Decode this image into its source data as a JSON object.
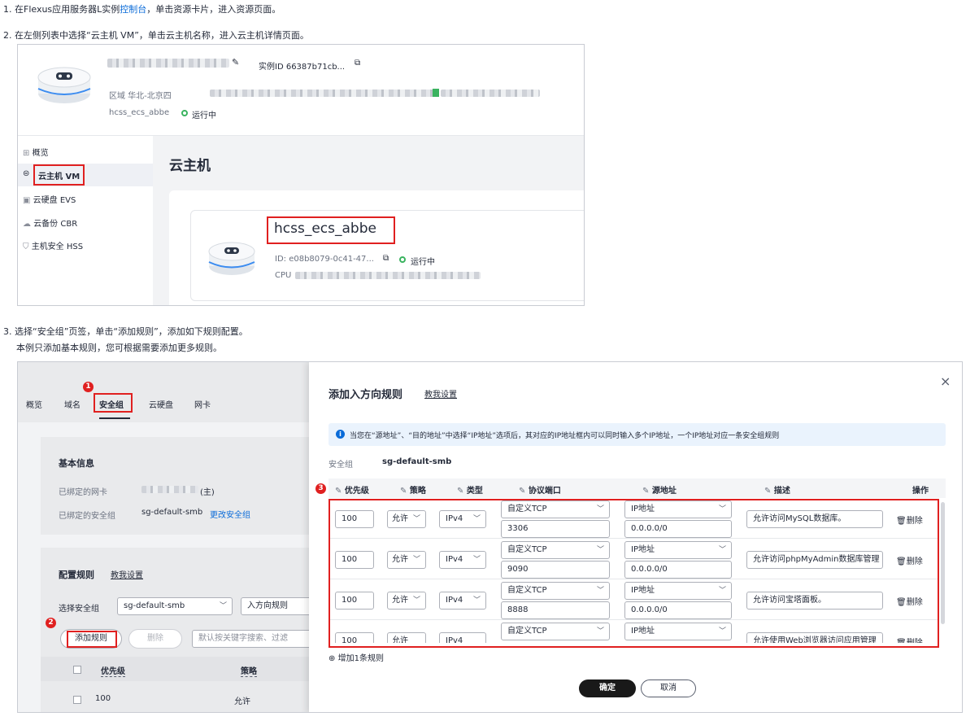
{
  "steps": {
    "s1_a": "1. 在Flexus应用服务器L实例",
    "s1_link": "控制台",
    "s1_b": "，单击资源卡片，进入资源页面。",
    "s2": "2. 在左侧列表中选择“云主机 VM”，单击云主机名称，进入云主机详情页面。",
    "s3": "3. 选择“安全组”页签，单击“添加规则”，添加如下规则配置。",
    "s3_sub": "本例只添加基本规则，您可根据需要添加更多规则。"
  },
  "shot1": {
    "instance_label": "实例ID 66387b71cb...",
    "region": "区域 华北-北京四",
    "host_name_small": "hcss_ecs_abbe",
    "status": "运行中",
    "nav": [
      "概览",
      "云主机 VM",
      "云硬盘 EVS",
      "云备份 CBR",
      "主机安全 HSS"
    ],
    "page_title": "云主机",
    "card_name": "hcss_ecs_abbe",
    "card_id": "ID: e08b8079-0c41-47...",
    "card_status": "运行中",
    "card_cpu": "CPU"
  },
  "shot2": {
    "tabs": [
      "概览",
      "域名",
      "安全组",
      "云硬盘",
      "网卡"
    ],
    "basic_title": "基本信息",
    "bound_nic": "已绑定的网卡",
    "nic_suffix": "(主)",
    "bound_sg": "已绑定的安全组",
    "sg_value": "sg-default-smb",
    "change_sg": "更改安全组",
    "config_title": "配置规则",
    "teach": "教我设置",
    "select_sg": "选择安全组",
    "sg_select_value": "sg-default-smb",
    "direction": "入方向规则",
    "add_rule": "添加规则",
    "delete": "删除",
    "search_placeholder": "默认按关键字搜索、过滤",
    "col_priority": "优先级",
    "col_policy": "策略",
    "row_priority": "100",
    "row_policy": "允许",
    "badges": [
      "1",
      "2",
      "3"
    ]
  },
  "dialog": {
    "title": "添加入方向规则",
    "teach": "教我设置",
    "close": "×",
    "info": "当您在“源地址”、“目的地址”中选择“IP地址”选项后，其对应的IP地址框内可以同时输入多个IP地址，一个IP地址对应一条安全组规则",
    "sg_label": "安全组",
    "sg_value": "sg-default-smb",
    "headers": [
      "优先级",
      "策略",
      "类型",
      "协议端口",
      "源地址",
      "描述",
      "操作"
    ],
    "rows": [
      {
        "priority": "100",
        "policy": "允许",
        "type": "IPv4",
        "protocol": "自定义TCP",
        "port": "3306",
        "src_type": "IP地址",
        "src": "0.0.0.0/0",
        "desc": "允许访问MySQL数据库。",
        "op": "删除"
      },
      {
        "priority": "100",
        "policy": "允许",
        "type": "IPv4",
        "protocol": "自定义TCP",
        "port": "9090",
        "src_type": "IP地址",
        "src": "0.0.0.0/0",
        "desc": "允许访问phpMyAdmin数据库管理",
        "op": "删除"
      },
      {
        "priority": "100",
        "policy": "允许",
        "type": "IPv4",
        "protocol": "自定义TCP",
        "port": "8888",
        "src_type": "IP地址",
        "src": "0.0.0.0/0",
        "desc": "允许访问宝塔面板。",
        "op": "删除"
      },
      {
        "priority": "100",
        "policy": "允许",
        "type": "IPv4",
        "protocol": "自定义TCP",
        "port": "",
        "src_type": "IP地址",
        "src": "",
        "desc": "允许使用Web浏览器访问应用管理",
        "op": "删除"
      }
    ],
    "add_one": "增加1条规则",
    "ok": "确定",
    "cancel": "取消"
  }
}
